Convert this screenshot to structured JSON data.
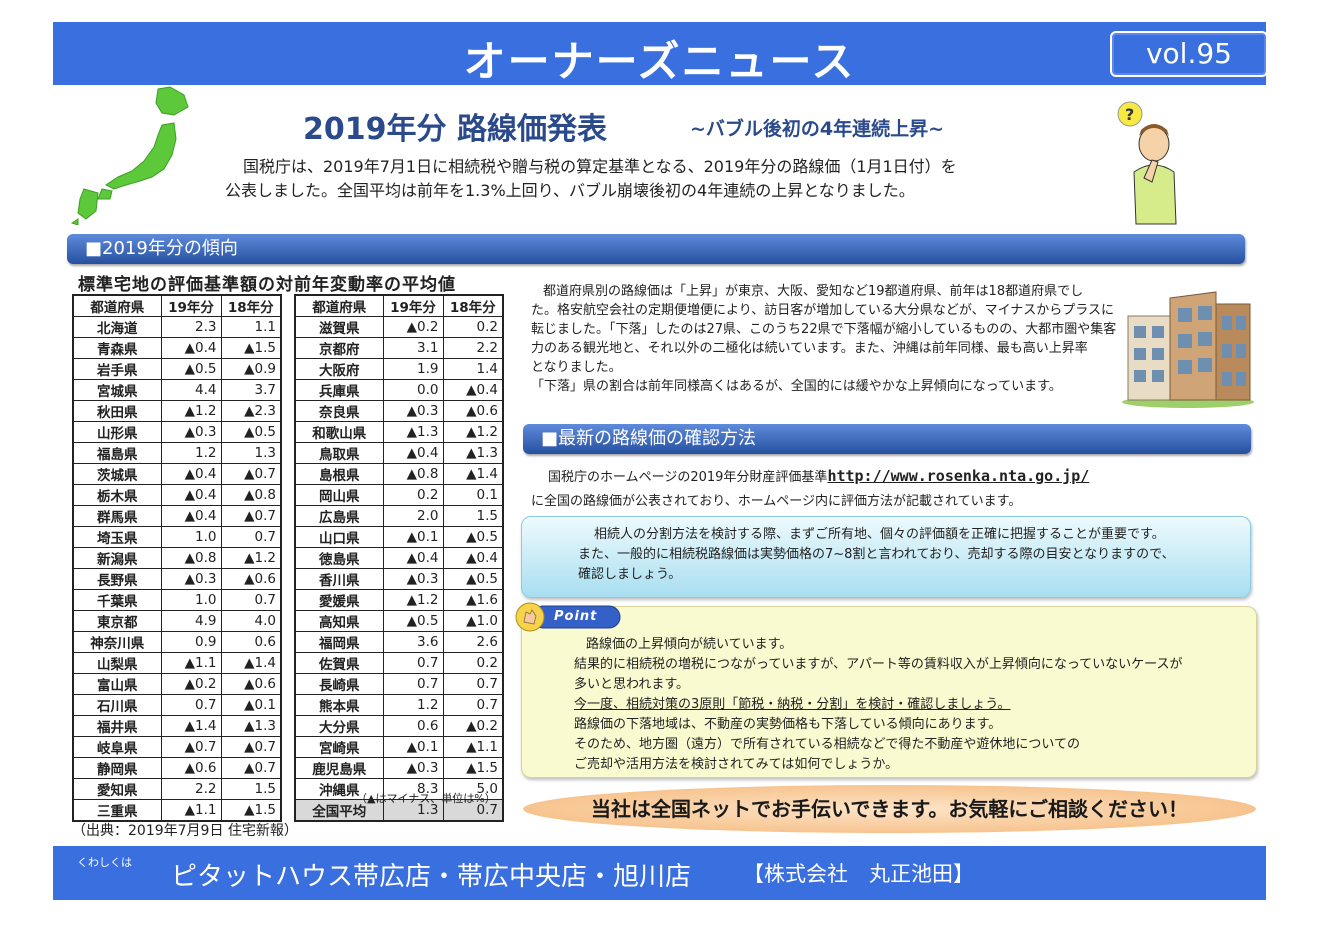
{
  "header": {
    "title": "オーナーズニュース",
    "volume": "vol.95"
  },
  "headline": {
    "title": "2019年分  路線価発表",
    "subtitle": "~バブル後初の4年連続上昇~",
    "intro_line1": "国税庁は、2019年7月1日に相続税や贈与税の算定基準となる、2019年分の路線価（1月1日付）を",
    "intro_line2": "公表しました。全国平均は前年を1.3%上回り、バブル崩壊後初の4年連続の上昇となりました。"
  },
  "section1": {
    "label": "■2019年分の傾向"
  },
  "table": {
    "title": "標準宅地の評価基準額の対前年変動率の平均値",
    "headers": [
      "都道府県",
      "19年分",
      "18年分"
    ],
    "left_rows": [
      [
        "北海道",
        "2.3",
        "1.1"
      ],
      [
        "青森県",
        "▲0.4",
        "▲1.5"
      ],
      [
        "岩手県",
        "▲0.5",
        "▲0.9"
      ],
      [
        "宮城県",
        "4.4",
        "3.7"
      ],
      [
        "秋田県",
        "▲1.2",
        "▲2.3"
      ],
      [
        "山形県",
        "▲0.3",
        "▲0.5"
      ],
      [
        "福島県",
        "1.2",
        "1.3"
      ],
      [
        "茨城県",
        "▲0.4",
        "▲0.7"
      ],
      [
        "栃木県",
        "▲0.4",
        "▲0.8"
      ],
      [
        "群馬県",
        "▲0.4",
        "▲0.7"
      ],
      [
        "埼玉県",
        "1.0",
        "0.7"
      ],
      [
        "新潟県",
        "▲0.8",
        "▲1.2"
      ],
      [
        "長野県",
        "▲0.3",
        "▲0.6"
      ],
      [
        "千葉県",
        "1.0",
        "0.7"
      ],
      [
        "東京都",
        "4.9",
        "4.0"
      ],
      [
        "神奈川県",
        "0.9",
        "0.6"
      ],
      [
        "山梨県",
        "▲1.1",
        "▲1.4"
      ],
      [
        "富山県",
        "▲0.2",
        "▲0.6"
      ],
      [
        "石川県",
        "0.7",
        "▲0.1"
      ],
      [
        "福井県",
        "▲1.4",
        "▲1.3"
      ],
      [
        "岐阜県",
        "▲0.7",
        "▲0.7"
      ],
      [
        "静岡県",
        "▲0.6",
        "▲0.7"
      ],
      [
        "愛知県",
        "2.2",
        "1.5"
      ],
      [
        "三重県",
        "▲1.1",
        "▲1.5"
      ]
    ],
    "right_rows": [
      [
        "滋賀県",
        "▲0.2",
        "0.2"
      ],
      [
        "京都府",
        "3.1",
        "2.2"
      ],
      [
        "大阪府",
        "1.9",
        "1.4"
      ],
      [
        "兵庫県",
        "0.0",
        "▲0.4"
      ],
      [
        "奈良県",
        "▲0.3",
        "▲0.6"
      ],
      [
        "和歌山県",
        "▲1.3",
        "▲1.2"
      ],
      [
        "鳥取県",
        "▲0.4",
        "▲1.3"
      ],
      [
        "島根県",
        "▲0.8",
        "▲1.4"
      ],
      [
        "岡山県",
        "0.2",
        "0.1"
      ],
      [
        "広島県",
        "2.0",
        "1.5"
      ],
      [
        "山口県",
        "▲0.1",
        "▲0.5"
      ],
      [
        "徳島県",
        "▲0.4",
        "▲0.4"
      ],
      [
        "香川県",
        "▲0.3",
        "▲0.5"
      ],
      [
        "愛媛県",
        "▲1.2",
        "▲1.6"
      ],
      [
        "高知県",
        "▲0.5",
        "▲1.0"
      ],
      [
        "福岡県",
        "3.6",
        "2.6"
      ],
      [
        "佐賀県",
        "0.7",
        "0.2"
      ],
      [
        "長崎県",
        "0.7",
        "0.7"
      ],
      [
        "熊本県",
        "1.2",
        "0.7"
      ],
      [
        "大分県",
        "0.6",
        "▲0.2"
      ],
      [
        "宮崎県",
        "▲0.1",
        "▲1.1"
      ],
      [
        "鹿児島県",
        "▲0.3",
        "▲1.5"
      ],
      [
        "沖縄県",
        "8.3",
        "5.0"
      ],
      [
        "全国平均",
        "1.3",
        "0.7"
      ]
    ],
    "note": "（▲はマイナス、単位は%）",
    "source": "（出典：2019年7月9日 住宅新報）"
  },
  "trend_text": {
    "l1": "都道府県別の路線価は「上昇」が東京、大阪、愛知など19都道府県、前年は18都道府県でし",
    "l2": "た。格安航空会社の定期便増便により、訪日客が増加している大分県などが、マイナスからプラスに",
    "l3": "転じました。「下落」したのは27県、このうち22県で下落幅が縮小しているものの、大都市圏や集客",
    "l4": "力のある観光地と、それ以外の二極化は続いています。また、沖縄は前年同様、最も高い上昇率",
    "l5": "となりました。",
    "l6": "「下落」県の割合は前年同様高くはあるが、全国的には緩やかな上昇傾向になっています。"
  },
  "section2": {
    "label": "■最新の路線価の確認方法"
  },
  "rosenka": {
    "prefix": "国税庁のホームページの2019年分財産評価基準",
    "url": "http://www.rosenka.nta.go.jp/",
    "line2": "に全国の路線価が公表されており、ホームページ内に評価方法が記載されています。"
  },
  "bluebox": {
    "l1": "相続人の分割方法を検討する際、まずご所有地、個々の評価額を正確に把握することが重要です。",
    "l2": "また、一般的に相続税路線価は実勢価格の7~8割と言われており、売却する際の目安となりますので、",
    "l3": "確認しましょう。"
  },
  "point": {
    "badge": "Point",
    "l1": "路線価の上昇傾向が続いています。",
    "l2": "結果的に相続税の増税につながっていますが、アパート等の賃料収入が上昇傾向になっていないケースが",
    "l3": "多いと思われます。",
    "l4": "今一度、相続対策の3原則「節税・納税・分割」を検討・確認しましょう。",
    "l5": "路線価の下落地域は、不動産の実勢価格も下落している傾向にあります。",
    "l6": "そのため、地方圏（遠方）で所有されている相続などで得た不動産や遊休地についての",
    "l7": "ご売却や活用方法を検討されてみては如何でしょうか。"
  },
  "cta": {
    "text": "当社は全国ネットでお手伝いできます。お気軽にご相談ください！"
  },
  "footer": {
    "small": "くわしくは",
    "stores": "ピタットハウス帯広店・帯広中央店・旭川店",
    "company": "【株式会社　丸正池田】"
  },
  "colors": {
    "header_blue": "#3a6fe0",
    "section_blue": "#264f9f",
    "map_green": "#5cc83a",
    "title_navy": "#2b4a8b"
  }
}
